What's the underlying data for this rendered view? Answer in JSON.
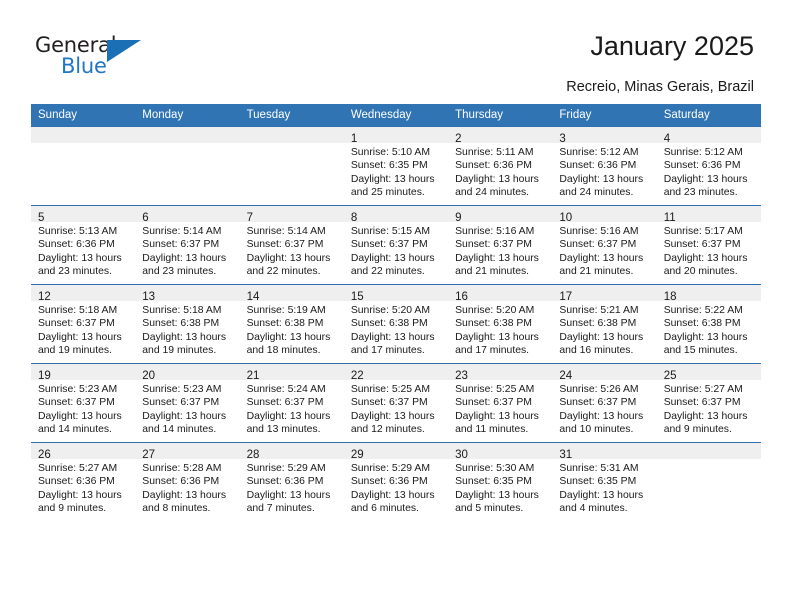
{
  "logo": {
    "word_top": "General",
    "word_bottom": "Blue",
    "triangle_color": "#1a6fb5",
    "text_color": "#231f20",
    "blue_color": "#2176c7"
  },
  "header": {
    "title": "January 2025",
    "subtitle": "Recreio, Minas Gerais, Brazil"
  },
  "theme": {
    "header_blue": "#3074b4",
    "row_divider": "#2f6fad",
    "daynum_strip": "#efefef",
    "text": "#1a1a1a"
  },
  "weekday_headers": [
    "Sunday",
    "Monday",
    "Tuesday",
    "Wednesday",
    "Thursday",
    "Friday",
    "Saturday"
  ],
  "weeks": [
    [
      {
        "day": "",
        "lines": []
      },
      {
        "day": "",
        "lines": []
      },
      {
        "day": "",
        "lines": []
      },
      {
        "day": "1",
        "lines": [
          "Sunrise: 5:10 AM",
          "Sunset: 6:35 PM",
          "Daylight: 13 hours",
          "and 25 minutes."
        ]
      },
      {
        "day": "2",
        "lines": [
          "Sunrise: 5:11 AM",
          "Sunset: 6:36 PM",
          "Daylight: 13 hours",
          "and 24 minutes."
        ]
      },
      {
        "day": "3",
        "lines": [
          "Sunrise: 5:12 AM",
          "Sunset: 6:36 PM",
          "Daylight: 13 hours",
          "and 24 minutes."
        ]
      },
      {
        "day": "4",
        "lines": [
          "Sunrise: 5:12 AM",
          "Sunset: 6:36 PM",
          "Daylight: 13 hours",
          "and 23 minutes."
        ]
      }
    ],
    [
      {
        "day": "5",
        "lines": [
          "Sunrise: 5:13 AM",
          "Sunset: 6:36 PM",
          "Daylight: 13 hours",
          "and 23 minutes."
        ]
      },
      {
        "day": "6",
        "lines": [
          "Sunrise: 5:14 AM",
          "Sunset: 6:37 PM",
          "Daylight: 13 hours",
          "and 23 minutes."
        ]
      },
      {
        "day": "7",
        "lines": [
          "Sunrise: 5:14 AM",
          "Sunset: 6:37 PM",
          "Daylight: 13 hours",
          "and 22 minutes."
        ]
      },
      {
        "day": "8",
        "lines": [
          "Sunrise: 5:15 AM",
          "Sunset: 6:37 PM",
          "Daylight: 13 hours",
          "and 22 minutes."
        ]
      },
      {
        "day": "9",
        "lines": [
          "Sunrise: 5:16 AM",
          "Sunset: 6:37 PM",
          "Daylight: 13 hours",
          "and 21 minutes."
        ]
      },
      {
        "day": "10",
        "lines": [
          "Sunrise: 5:16 AM",
          "Sunset: 6:37 PM",
          "Daylight: 13 hours",
          "and 21 minutes."
        ]
      },
      {
        "day": "11",
        "lines": [
          "Sunrise: 5:17 AM",
          "Sunset: 6:37 PM",
          "Daylight: 13 hours",
          "and 20 minutes."
        ]
      }
    ],
    [
      {
        "day": "12",
        "lines": [
          "Sunrise: 5:18 AM",
          "Sunset: 6:37 PM",
          "Daylight: 13 hours",
          "and 19 minutes."
        ]
      },
      {
        "day": "13",
        "lines": [
          "Sunrise: 5:18 AM",
          "Sunset: 6:38 PM",
          "Daylight: 13 hours",
          "and 19 minutes."
        ]
      },
      {
        "day": "14",
        "lines": [
          "Sunrise: 5:19 AM",
          "Sunset: 6:38 PM",
          "Daylight: 13 hours",
          "and 18 minutes."
        ]
      },
      {
        "day": "15",
        "lines": [
          "Sunrise: 5:20 AM",
          "Sunset: 6:38 PM",
          "Daylight: 13 hours",
          "and 17 minutes."
        ]
      },
      {
        "day": "16",
        "lines": [
          "Sunrise: 5:20 AM",
          "Sunset: 6:38 PM",
          "Daylight: 13 hours",
          "and 17 minutes."
        ]
      },
      {
        "day": "17",
        "lines": [
          "Sunrise: 5:21 AM",
          "Sunset: 6:38 PM",
          "Daylight: 13 hours",
          "and 16 minutes."
        ]
      },
      {
        "day": "18",
        "lines": [
          "Sunrise: 5:22 AM",
          "Sunset: 6:38 PM",
          "Daylight: 13 hours",
          "and 15 minutes."
        ]
      }
    ],
    [
      {
        "day": "19",
        "lines": [
          "Sunrise: 5:23 AM",
          "Sunset: 6:37 PM",
          "Daylight: 13 hours",
          "and 14 minutes."
        ]
      },
      {
        "day": "20",
        "lines": [
          "Sunrise: 5:23 AM",
          "Sunset: 6:37 PM",
          "Daylight: 13 hours",
          "and 14 minutes."
        ]
      },
      {
        "day": "21",
        "lines": [
          "Sunrise: 5:24 AM",
          "Sunset: 6:37 PM",
          "Daylight: 13 hours",
          "and 13 minutes."
        ]
      },
      {
        "day": "22",
        "lines": [
          "Sunrise: 5:25 AM",
          "Sunset: 6:37 PM",
          "Daylight: 13 hours",
          "and 12 minutes."
        ]
      },
      {
        "day": "23",
        "lines": [
          "Sunrise: 5:25 AM",
          "Sunset: 6:37 PM",
          "Daylight: 13 hours",
          "and 11 minutes."
        ]
      },
      {
        "day": "24",
        "lines": [
          "Sunrise: 5:26 AM",
          "Sunset: 6:37 PM",
          "Daylight: 13 hours",
          "and 10 minutes."
        ]
      },
      {
        "day": "25",
        "lines": [
          "Sunrise: 5:27 AM",
          "Sunset: 6:37 PM",
          "Daylight: 13 hours",
          "and 9 minutes."
        ]
      }
    ],
    [
      {
        "day": "26",
        "lines": [
          "Sunrise: 5:27 AM",
          "Sunset: 6:36 PM",
          "Daylight: 13 hours",
          "and 9 minutes."
        ]
      },
      {
        "day": "27",
        "lines": [
          "Sunrise: 5:28 AM",
          "Sunset: 6:36 PM",
          "Daylight: 13 hours",
          "and 8 minutes."
        ]
      },
      {
        "day": "28",
        "lines": [
          "Sunrise: 5:29 AM",
          "Sunset: 6:36 PM",
          "Daylight: 13 hours",
          "and 7 minutes."
        ]
      },
      {
        "day": "29",
        "lines": [
          "Sunrise: 5:29 AM",
          "Sunset: 6:36 PM",
          "Daylight: 13 hours",
          "and 6 minutes."
        ]
      },
      {
        "day": "30",
        "lines": [
          "Sunrise: 5:30 AM",
          "Sunset: 6:35 PM",
          "Daylight: 13 hours",
          "and 5 minutes."
        ]
      },
      {
        "day": "31",
        "lines": [
          "Sunrise: 5:31 AM",
          "Sunset: 6:35 PM",
          "Daylight: 13 hours",
          "and 4 minutes."
        ]
      },
      {
        "day": "",
        "lines": []
      }
    ]
  ]
}
